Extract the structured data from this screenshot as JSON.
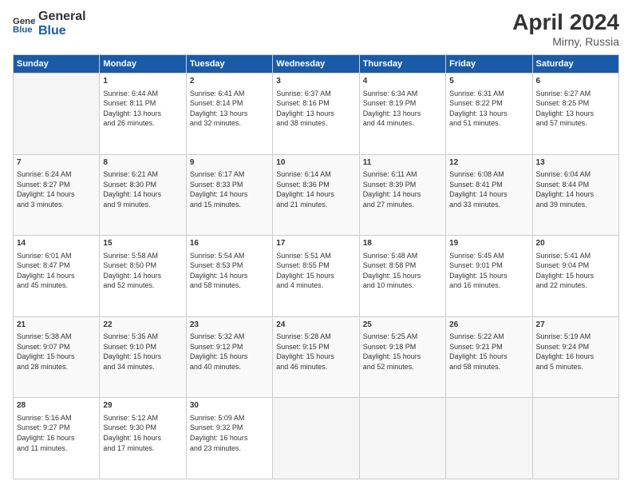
{
  "header": {
    "logo_line1": "General",
    "logo_line2": "Blue",
    "title": "April 2024",
    "subtitle": "Mirny, Russia"
  },
  "columns": [
    "Sunday",
    "Monday",
    "Tuesday",
    "Wednesday",
    "Thursday",
    "Friday",
    "Saturday"
  ],
  "weeks": [
    [
      {
        "day": "",
        "info": ""
      },
      {
        "day": "1",
        "info": "Sunrise: 6:44 AM\nSunset: 8:11 PM\nDaylight: 13 hours\nand 26 minutes."
      },
      {
        "day": "2",
        "info": "Sunrise: 6:41 AM\nSunset: 8:14 PM\nDaylight: 13 hours\nand 32 minutes."
      },
      {
        "day": "3",
        "info": "Sunrise: 6:37 AM\nSunset: 8:16 PM\nDaylight: 13 hours\nand 38 minutes."
      },
      {
        "day": "4",
        "info": "Sunrise: 6:34 AM\nSunset: 8:19 PM\nDaylight: 13 hours\nand 44 minutes."
      },
      {
        "day": "5",
        "info": "Sunrise: 6:31 AM\nSunset: 8:22 PM\nDaylight: 13 hours\nand 51 minutes."
      },
      {
        "day": "6",
        "info": "Sunrise: 6:27 AM\nSunset: 8:25 PM\nDaylight: 13 hours\nand 57 minutes."
      }
    ],
    [
      {
        "day": "7",
        "info": "Sunrise: 6:24 AM\nSunset: 8:27 PM\nDaylight: 14 hours\nand 3 minutes."
      },
      {
        "day": "8",
        "info": "Sunrise: 6:21 AM\nSunset: 8:30 PM\nDaylight: 14 hours\nand 9 minutes."
      },
      {
        "day": "9",
        "info": "Sunrise: 6:17 AM\nSunset: 8:33 PM\nDaylight: 14 hours\nand 15 minutes."
      },
      {
        "day": "10",
        "info": "Sunrise: 6:14 AM\nSunset: 8:36 PM\nDaylight: 14 hours\nand 21 minutes."
      },
      {
        "day": "11",
        "info": "Sunrise: 6:11 AM\nSunset: 8:39 PM\nDaylight: 14 hours\nand 27 minutes."
      },
      {
        "day": "12",
        "info": "Sunrise: 6:08 AM\nSunset: 8:41 PM\nDaylight: 14 hours\nand 33 minutes."
      },
      {
        "day": "13",
        "info": "Sunrise: 6:04 AM\nSunset: 8:44 PM\nDaylight: 14 hours\nand 39 minutes."
      }
    ],
    [
      {
        "day": "14",
        "info": "Sunrise: 6:01 AM\nSunset: 8:47 PM\nDaylight: 14 hours\nand 45 minutes."
      },
      {
        "day": "15",
        "info": "Sunrise: 5:58 AM\nSunset: 8:50 PM\nDaylight: 14 hours\nand 52 minutes."
      },
      {
        "day": "16",
        "info": "Sunrise: 5:54 AM\nSunset: 8:53 PM\nDaylight: 14 hours\nand 58 minutes."
      },
      {
        "day": "17",
        "info": "Sunrise: 5:51 AM\nSunset: 8:55 PM\nDaylight: 15 hours\nand 4 minutes."
      },
      {
        "day": "18",
        "info": "Sunrise: 5:48 AM\nSunset: 8:58 PM\nDaylight: 15 hours\nand 10 minutes."
      },
      {
        "day": "19",
        "info": "Sunrise: 5:45 AM\nSunset: 9:01 PM\nDaylight: 15 hours\nand 16 minutes."
      },
      {
        "day": "20",
        "info": "Sunrise: 5:41 AM\nSunset: 9:04 PM\nDaylight: 15 hours\nand 22 minutes."
      }
    ],
    [
      {
        "day": "21",
        "info": "Sunrise: 5:38 AM\nSunset: 9:07 PM\nDaylight: 15 hours\nand 28 minutes."
      },
      {
        "day": "22",
        "info": "Sunrise: 5:35 AM\nSunset: 9:10 PM\nDaylight: 15 hours\nand 34 minutes."
      },
      {
        "day": "23",
        "info": "Sunrise: 5:32 AM\nSunset: 9:12 PM\nDaylight: 15 hours\nand 40 minutes."
      },
      {
        "day": "24",
        "info": "Sunrise: 5:28 AM\nSunset: 9:15 PM\nDaylight: 15 hours\nand 46 minutes."
      },
      {
        "day": "25",
        "info": "Sunrise: 5:25 AM\nSunset: 9:18 PM\nDaylight: 15 hours\nand 52 minutes."
      },
      {
        "day": "26",
        "info": "Sunrise: 5:22 AM\nSunset: 9:21 PM\nDaylight: 15 hours\nand 58 minutes."
      },
      {
        "day": "27",
        "info": "Sunrise: 5:19 AM\nSunset: 9:24 PM\nDaylight: 16 hours\nand 5 minutes."
      }
    ],
    [
      {
        "day": "28",
        "info": "Sunrise: 5:16 AM\nSunset: 9:27 PM\nDaylight: 16 hours\nand 11 minutes."
      },
      {
        "day": "29",
        "info": "Sunrise: 5:12 AM\nSunset: 9:30 PM\nDaylight: 16 hours\nand 17 minutes."
      },
      {
        "day": "30",
        "info": "Sunrise: 5:09 AM\nSunset: 9:32 PM\nDaylight: 16 hours\nand 23 minutes."
      },
      {
        "day": "",
        "info": ""
      },
      {
        "day": "",
        "info": ""
      },
      {
        "day": "",
        "info": ""
      },
      {
        "day": "",
        "info": ""
      }
    ]
  ]
}
